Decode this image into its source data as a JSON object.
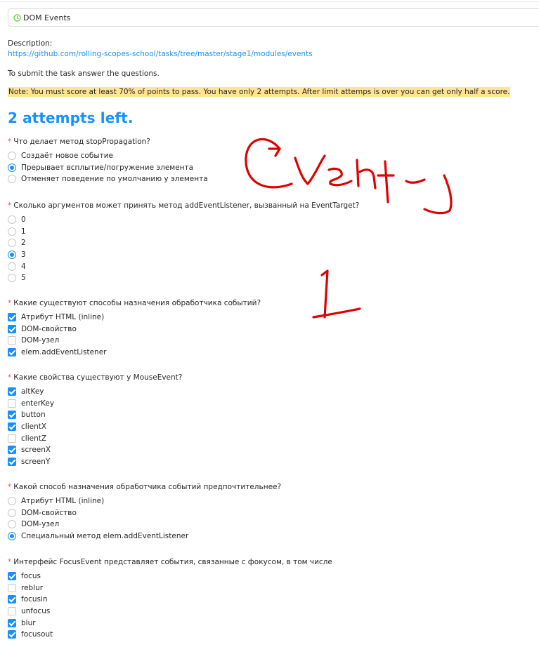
{
  "task_select": {
    "value": "DOM Events"
  },
  "description": {
    "label": "Description:",
    "link": "https://github.com/rolling-scopes-school/tasks/tree/master/stage1/modules/events"
  },
  "submit_text": "To submit the task answer the questions.",
  "note": "Note: You must score at least 70% of points to pass. You have only 2 attempts. After limit attemps is over you can get only half a score.",
  "attempts_left": "2 attempts left.",
  "required_mark": "*",
  "colors": {
    "accent": "#1890ff",
    "required": "#ff4d4f",
    "note_bg": "#ffe58f",
    "scribble": "#e00000"
  },
  "questions": [
    {
      "title": "Что делает метод stopPropagation?",
      "type": "radio",
      "options": [
        {
          "label": "Создаёт новое событие",
          "selected": false
        },
        {
          "label": "Прерывает всплытие/погружение элемента",
          "selected": true
        },
        {
          "label": "Отменяет поведение по умолчанию у элемента",
          "selected": false
        }
      ]
    },
    {
      "title": "Сколько аргументов может принять метод addEventListener, вызванный на EventTarget?",
      "type": "radio",
      "options": [
        {
          "label": "0",
          "selected": false
        },
        {
          "label": "1",
          "selected": false
        },
        {
          "label": "2",
          "selected": false
        },
        {
          "label": "3",
          "selected": true
        },
        {
          "label": "4",
          "selected": false
        },
        {
          "label": "5",
          "selected": false
        }
      ]
    },
    {
      "title": "Какие существуют способы назначения обработчика событий?",
      "type": "checkbox",
      "options": [
        {
          "label": "Атрибут HTML (inline)",
          "selected": true
        },
        {
          "label": "DOM-свойство",
          "selected": true
        },
        {
          "label": "DOM-узел",
          "selected": false
        },
        {
          "label": "elem.addEventListener",
          "selected": true
        }
      ]
    },
    {
      "title": "Какие свойства существуют у MouseEvent?",
      "type": "checkbox",
      "options": [
        {
          "label": "altKey",
          "selected": true
        },
        {
          "label": "enterKey",
          "selected": false
        },
        {
          "label": "button",
          "selected": true
        },
        {
          "label": "clientX",
          "selected": true
        },
        {
          "label": "clientZ",
          "selected": false
        },
        {
          "label": "screenX",
          "selected": true
        },
        {
          "label": "screenY",
          "selected": true
        }
      ]
    },
    {
      "title": "Какой способ назначения обработчика событий предпочтительнее?",
      "type": "radio",
      "options": [
        {
          "label": "Атрибут HTML (inline)",
          "selected": false
        },
        {
          "label": "DOM-свойство",
          "selected": false
        },
        {
          "label": "DOM-узел",
          "selected": false
        },
        {
          "label": "Специальный метод elem.addEventListener",
          "selected": true
        }
      ]
    },
    {
      "title": "Интерфейс FocusEvent представляет события, связанные с фокусом, в том числе",
      "type": "checkbox",
      "options": [
        {
          "label": "focus",
          "selected": true
        },
        {
          "label": "reblur",
          "selected": false
        },
        {
          "label": "focusin",
          "selected": true
        },
        {
          "label": "unfocus",
          "selected": false
        },
        {
          "label": "blur",
          "selected": true
        },
        {
          "label": "focusout",
          "selected": true
        }
      ]
    }
  ]
}
